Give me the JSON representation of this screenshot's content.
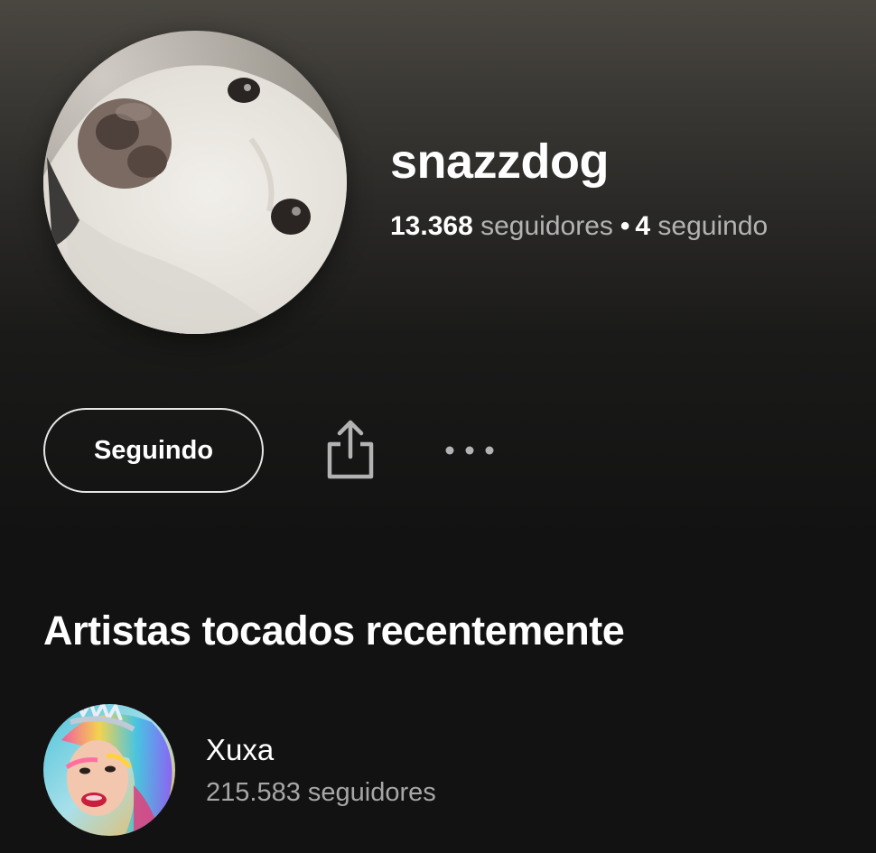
{
  "profile": {
    "name": "snazzdog",
    "followers_count": "13.368",
    "followers_label": "seguidores",
    "separator": "•",
    "following_count": "4",
    "following_label": "seguindo",
    "avatar_icon": "dog-photo"
  },
  "actions": {
    "follow_label": "Seguindo",
    "share_icon": "share-icon",
    "more_icon": "more-options-icon"
  },
  "recent_artists": {
    "title": "Artistas tocados recentemente",
    "items": [
      {
        "name": "Xuxa",
        "followers": "215.583 seguidores",
        "image_icon": "artist-photo"
      }
    ]
  },
  "colors": {
    "background": "#121212",
    "header_gradient_top": "#4a4741",
    "text_primary": "#ffffff",
    "text_secondary": "#b3b3b3"
  }
}
